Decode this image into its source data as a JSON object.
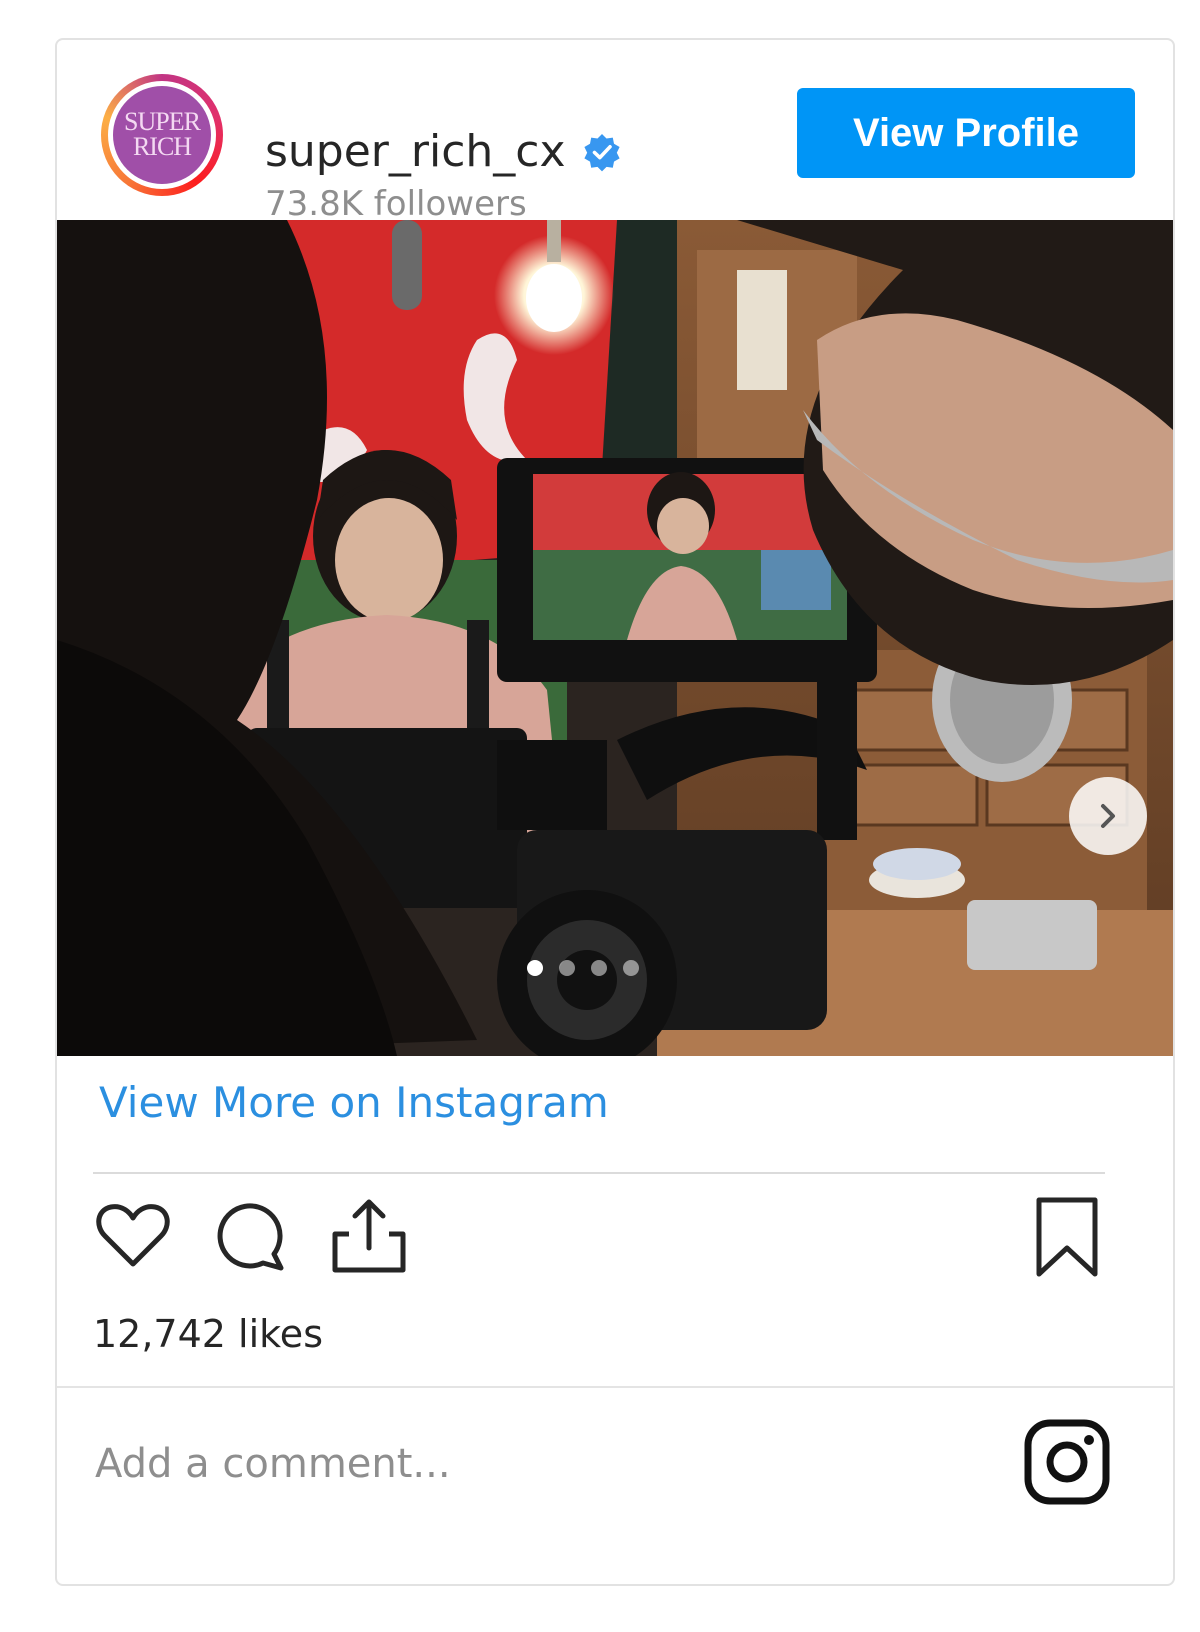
{
  "header": {
    "avatar_text_line1": "SUPER",
    "avatar_text_line2": "RICH",
    "username": "super_rich_cx",
    "followers": "73.8K followers",
    "view_profile_label": "View Profile",
    "verified_icon": "verified-badge-icon"
  },
  "post": {
    "image_description_icon": "photo",
    "carousel_dots": 4,
    "active_dot": 1,
    "next_icon": "chevron-right-icon"
  },
  "links": {
    "view_more": "View More on Instagram"
  },
  "actions": {
    "like_icon": "heart-icon",
    "comment_icon": "comment-icon",
    "share_icon": "share-icon",
    "save_icon": "bookmark-icon"
  },
  "likes": "12,742 likes",
  "comment": {
    "placeholder": "Add a comment..."
  },
  "footer": {
    "logo_icon": "instagram-icon"
  },
  "colors": {
    "primary_button": "#0095f6",
    "link": "#2b8fe0",
    "text": "#262626",
    "muted": "#8e8e8e",
    "border": "#dbdbdb"
  }
}
